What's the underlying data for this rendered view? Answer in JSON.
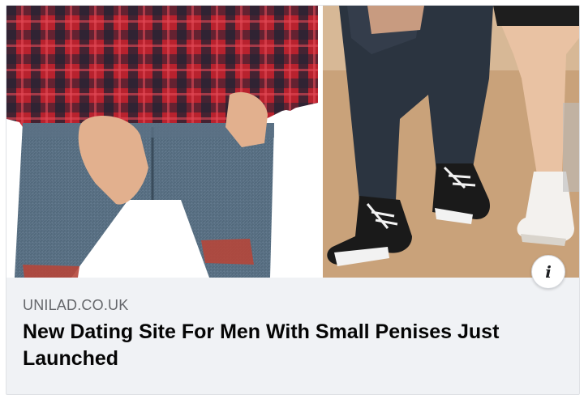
{
  "link_preview": {
    "domain": "UNILAD.CO.UK",
    "headline": "New Dating Site For Men With Small Penises Just Launched"
  },
  "images": {
    "left_photo": "man in red plaid shirt and ripped jeans",
    "right_photo": "couple's legs in jeans and sneakers sitting on ledge"
  },
  "icons": {
    "info": "i"
  },
  "colors": {
    "caption_background": "#f0f2f5",
    "domain_text": "#65676b",
    "headline_text": "#050505",
    "plaid_red": "#b8222e",
    "denim": "#4f6679"
  }
}
